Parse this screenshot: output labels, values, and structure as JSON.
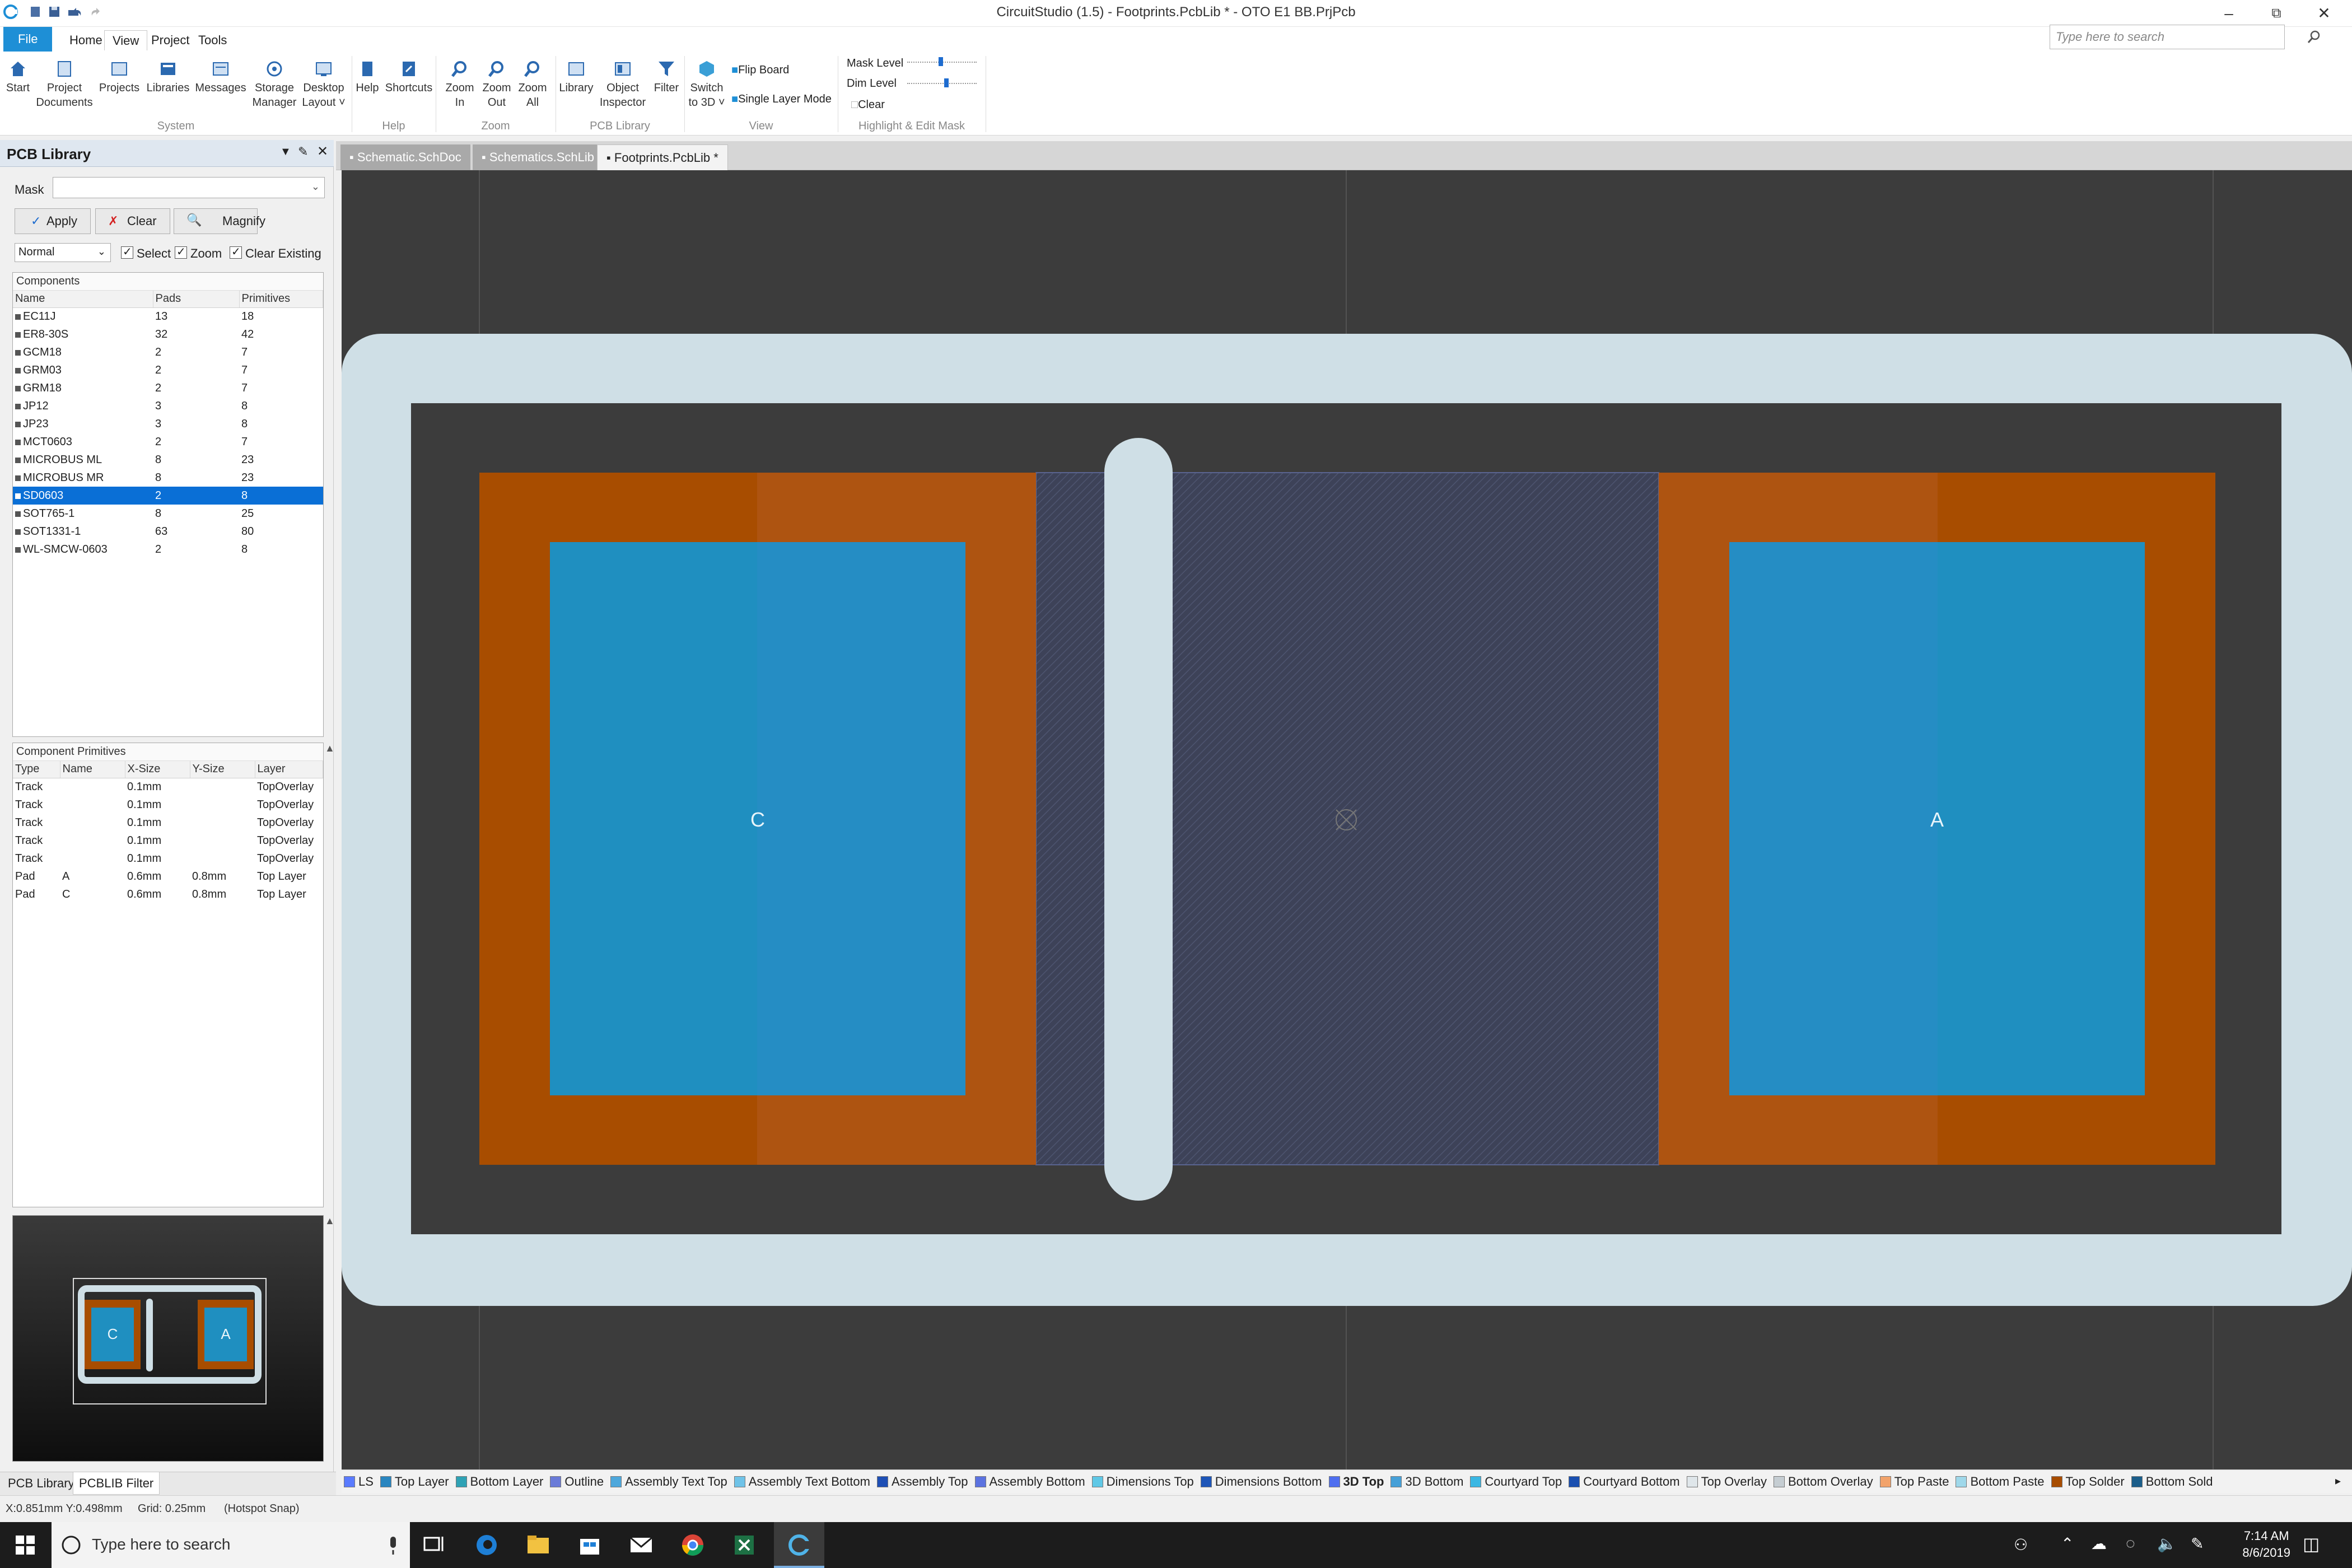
{
  "window": {
    "title": "CircuitStudio (1.5) - Footprints.PcbLib * - OTO E1 BB.PrjPcb",
    "search_placeholder": "Type here to search"
  },
  "menu": [
    "File",
    "Home",
    "View",
    "Project",
    "Tools"
  ],
  "ribbon": {
    "buttons": [
      {
        "l1": "Start",
        "l2": ""
      },
      {
        "l1": "Project",
        "l2": "Documents"
      },
      {
        "l1": "Projects",
        "l2": ""
      },
      {
        "l1": "Libraries",
        "l2": ""
      },
      {
        "l1": "Messages",
        "l2": ""
      },
      {
        "l1": "Storage",
        "l2": "Manager"
      },
      {
        "l1": "Desktop",
        "l2": "Layout ˅"
      },
      {
        "l1": "Help",
        "l2": ""
      },
      {
        "l1": "Shortcuts",
        "l2": ""
      },
      {
        "l1": "Zoom",
        "l2": "In"
      },
      {
        "l1": "Zoom",
        "l2": "Out"
      },
      {
        "l1": "Zoom",
        "l2": "All"
      },
      {
        "l1": "Library",
        "l2": ""
      },
      {
        "l1": "Object",
        "l2": "Inspector"
      },
      {
        "l1": "Filter",
        "l2": ""
      },
      {
        "l1": "Switch",
        "l2": "to 3D ˅"
      }
    ],
    "view_options": {
      "flip": "Flip Board",
      "single": "Single Layer Mode"
    },
    "mask": {
      "mask_level": "Mask Level",
      "dim_level": "Dim Level",
      "clear": "Clear"
    },
    "groups": [
      "System",
      "Help",
      "Zoom",
      "PCB Library",
      "View",
      "Highlight & Edit Mask"
    ]
  },
  "panel": {
    "title": "PCB Library",
    "mask_label": "Mask",
    "apply": "Apply",
    "clear": "Clear",
    "magnify": "Magnify",
    "mode": "Normal",
    "opt_select": "Select",
    "opt_zoom": "Zoom",
    "opt_clear_existing": "Clear Existing",
    "components_title": "Components",
    "components_headers": [
      "Name",
      "Pads",
      "Primitives"
    ],
    "components": [
      [
        "EC11J",
        "13",
        "18"
      ],
      [
        "ER8-30S",
        "32",
        "42"
      ],
      [
        "GCM18",
        "2",
        "7"
      ],
      [
        "GRM03",
        "2",
        "7"
      ],
      [
        "GRM18",
        "2",
        "7"
      ],
      [
        "JP12",
        "3",
        "8"
      ],
      [
        "JP23",
        "3",
        "8"
      ],
      [
        "MCT0603",
        "2",
        "7"
      ],
      [
        "MICROBUS ML",
        "8",
        "23"
      ],
      [
        "MICROBUS MR",
        "8",
        "23"
      ],
      [
        "SD0603",
        "2",
        "8"
      ],
      [
        "SOT765-1",
        "8",
        "25"
      ],
      [
        "SOT1331-1",
        "63",
        "80"
      ],
      [
        "WL-SMCW-0603",
        "2",
        "8"
      ]
    ],
    "selected_index": 10,
    "primitives_title": "Component Primitives",
    "primitives_headers": [
      "Type",
      "Name",
      "X-Size",
      "Y-Size",
      "Layer"
    ],
    "primitives": [
      [
        "Track",
        "",
        "0.1mm",
        "",
        "TopOverlay"
      ],
      [
        "Track",
        "",
        "0.1mm",
        "",
        "TopOverlay"
      ],
      [
        "Track",
        "",
        "0.1mm",
        "",
        "TopOverlay"
      ],
      [
        "Track",
        "",
        "0.1mm",
        "",
        "TopOverlay"
      ],
      [
        "Track",
        "",
        "0.1mm",
        "",
        "TopOverlay"
      ],
      [
        "Pad",
        "A",
        "0.6mm",
        "0.8mm",
        "Top Layer"
      ],
      [
        "Pad",
        "C",
        "0.6mm",
        "0.8mm",
        "Top Layer"
      ]
    ],
    "preview_labels": {
      "c": "C",
      "a": "A"
    }
  },
  "doc_tabs": [
    "Schematic.SchDoc",
    "Schematics.SchLib",
    "Footprints.PcbLib *"
  ],
  "canvas": {
    "pad_c": "C",
    "pad_a": "A"
  },
  "panel_tabs": [
    "PCB Library",
    "PCBLIB Filter"
  ],
  "layers": [
    {
      "name": "LS",
      "color": "#5a7bff"
    },
    {
      "name": "Top Layer",
      "color": "#2a86c0"
    },
    {
      "name": "Bottom Layer",
      "color": "#2fa2b5"
    },
    {
      "name": "Outline",
      "color": "#6a7bd8"
    },
    {
      "name": "Assembly Text Top",
      "color": "#4ea8dc"
    },
    {
      "name": "Assembly Text Bottom",
      "color": "#6fc3e8"
    },
    {
      "name": "Assembly Top",
      "color": "#1e4fb5"
    },
    {
      "name": "Assembly Bottom",
      "color": "#5b72e0"
    },
    {
      "name": "Dimensions Top",
      "color": "#5fc8e6"
    },
    {
      "name": "Dimensions Bottom",
      "color": "#1e56b8"
    },
    {
      "name": "3D Top",
      "color": "#4f6ff0"
    },
    {
      "name": "3D Bottom",
      "color": "#46a0d8"
    },
    {
      "name": "Courtyard Top",
      "color": "#3ab7e3"
    },
    {
      "name": "Courtyard Bottom",
      "color": "#1a4fb0"
    },
    {
      "name": "Top Overlay",
      "color": "#dfe6ea"
    },
    {
      "name": "Bottom Overlay",
      "color": "#c5cdd2"
    },
    {
      "name": "Top Paste",
      "color": "#f2a36b"
    },
    {
      "name": "Bottom Paste",
      "color": "#9fd8ea"
    },
    {
      "name": "Top Solder",
      "color": "#a84d00"
    },
    {
      "name": "Bottom Sold",
      "color": "#1b5e8a"
    }
  ],
  "active_layer": "3D Top",
  "status": {
    "coords": "X:0.851mm Y:0.498mm",
    "grid": "Grid: 0.25mm",
    "snap": "(Hotspot Snap)"
  },
  "taskbar": {
    "search": "Type here to search",
    "time": "7:14 AM",
    "date": "8/6/2019"
  },
  "colors": {
    "accent": "#1e8fd6",
    "selection": "#0a6fd6",
    "solder": "#a84d00",
    "pad": "#1f8fc0",
    "overlay": "#cfdfe6",
    "board": "#3c3c3c"
  }
}
